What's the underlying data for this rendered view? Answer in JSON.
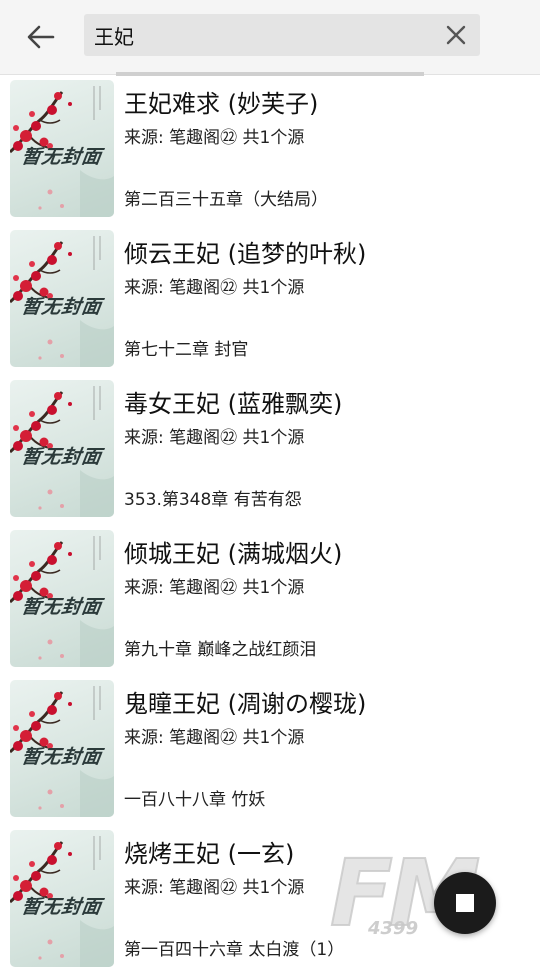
{
  "search": {
    "query": "王妃"
  },
  "results": [
    {
      "title": "王妃难求 (妙芙子)",
      "source": "来源: 笔趣阁㉒ 共1个源",
      "chapter": "第二百三十五章（大结局）",
      "cover_text": "暂无封面"
    },
    {
      "title": "倾云王妃 (追梦的叶秋)",
      "source": "来源: 笔趣阁㉒ 共1个源",
      "chapter": "第七十二章 封官",
      "cover_text": "暂无封面"
    },
    {
      "title": "毒女王妃 (蓝雅飘奕)",
      "source": "来源: 笔趣阁㉒ 共1个源",
      "chapter": "353.第348章 有苦有怨",
      "cover_text": "暂无封面"
    },
    {
      "title": "倾城王妃 (满城烟火)",
      "source": "来源: 笔趣阁㉒ 共1个源",
      "chapter": "第九十章 巅峰之战红颜泪",
      "cover_text": "暂无封面"
    },
    {
      "title": "鬼瞳王妃 (凋谢の樱珑)",
      "source": "来源: 笔趣阁㉒ 共1个源",
      "chapter": "一百八十八章 竹妖",
      "cover_text": "暂无封面"
    },
    {
      "title": "烧烤王妃 (一玄)",
      "source": "来源: 笔趣阁㉒ 共1个源",
      "chapter": "第一百四十六章 太白渡（1）",
      "cover_text": "暂无封面"
    }
  ],
  "watermark": {
    "main": "FM",
    "sub": "4399"
  },
  "icons": {
    "back": "arrow-left-icon",
    "clear": "close-icon",
    "fab": "stop-square-icon"
  },
  "colors": {
    "topbar_bg": "#f5f5f5",
    "search_bg": "#e4e4e4",
    "fab_bg": "#1b1b1b"
  }
}
